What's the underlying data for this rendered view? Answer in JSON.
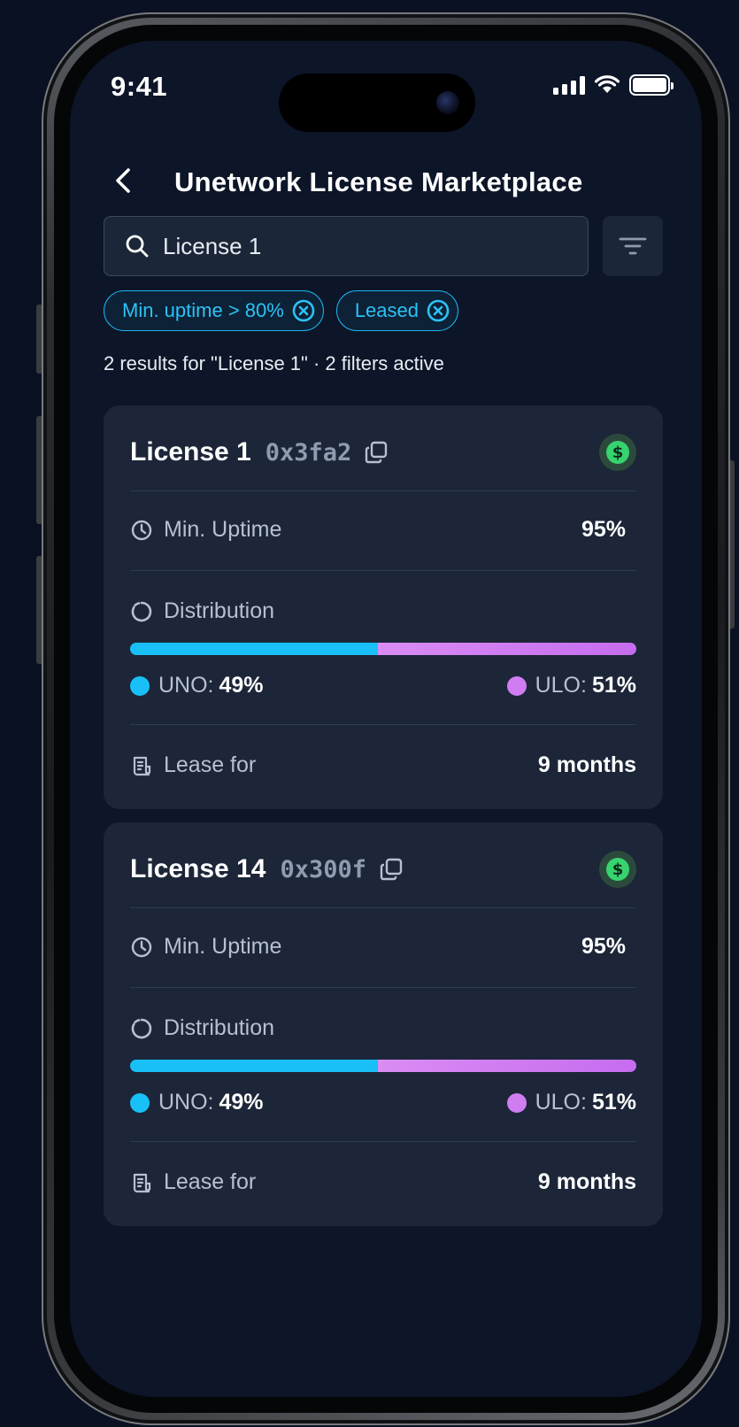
{
  "status_bar": {
    "time": "9:41"
  },
  "header": {
    "title": "Unetwork License Marketplace"
  },
  "search": {
    "value": "License 1"
  },
  "filters": [
    {
      "label": "Min. uptime > 80%"
    },
    {
      "label": "Leased"
    }
  ],
  "results_text": "2 results for \"License 1\" · 2 filters active",
  "labels": {
    "min_uptime": "Min. Uptime",
    "distribution": "Distribution",
    "lease_for": "Lease for",
    "uno": "UNO:",
    "ulo": "ULO:"
  },
  "licenses": [
    {
      "name": "License 1",
      "address": "0x3fa2",
      "min_uptime": "95%",
      "uno_percent": "49%",
      "ulo_percent": "51%",
      "uno_share": 0.49,
      "lease_for": "9 months"
    },
    {
      "name": "License 14",
      "address": "0x300f",
      "min_uptime": "95%",
      "uno_percent": "49%",
      "ulo_percent": "51%",
      "uno_share": 0.49,
      "lease_for": "9 months"
    }
  ],
  "colors": {
    "background": "#0d1528",
    "card": "#1c2638",
    "accent": "#1ab6f0",
    "uno": "#18c0f7",
    "ulo": "#d07df1",
    "lease_badge": "#36d36f"
  },
  "icons": {
    "back": "chevron-left-icon",
    "search": "search-icon",
    "filter": "filter-lines-icon",
    "chip_remove": "close-circle-icon",
    "copy": "copy-icon",
    "lease_badge": "dollar-icon",
    "uptime": "clock-icon",
    "distribution": "donut-icon",
    "lease": "receipt-icon"
  }
}
